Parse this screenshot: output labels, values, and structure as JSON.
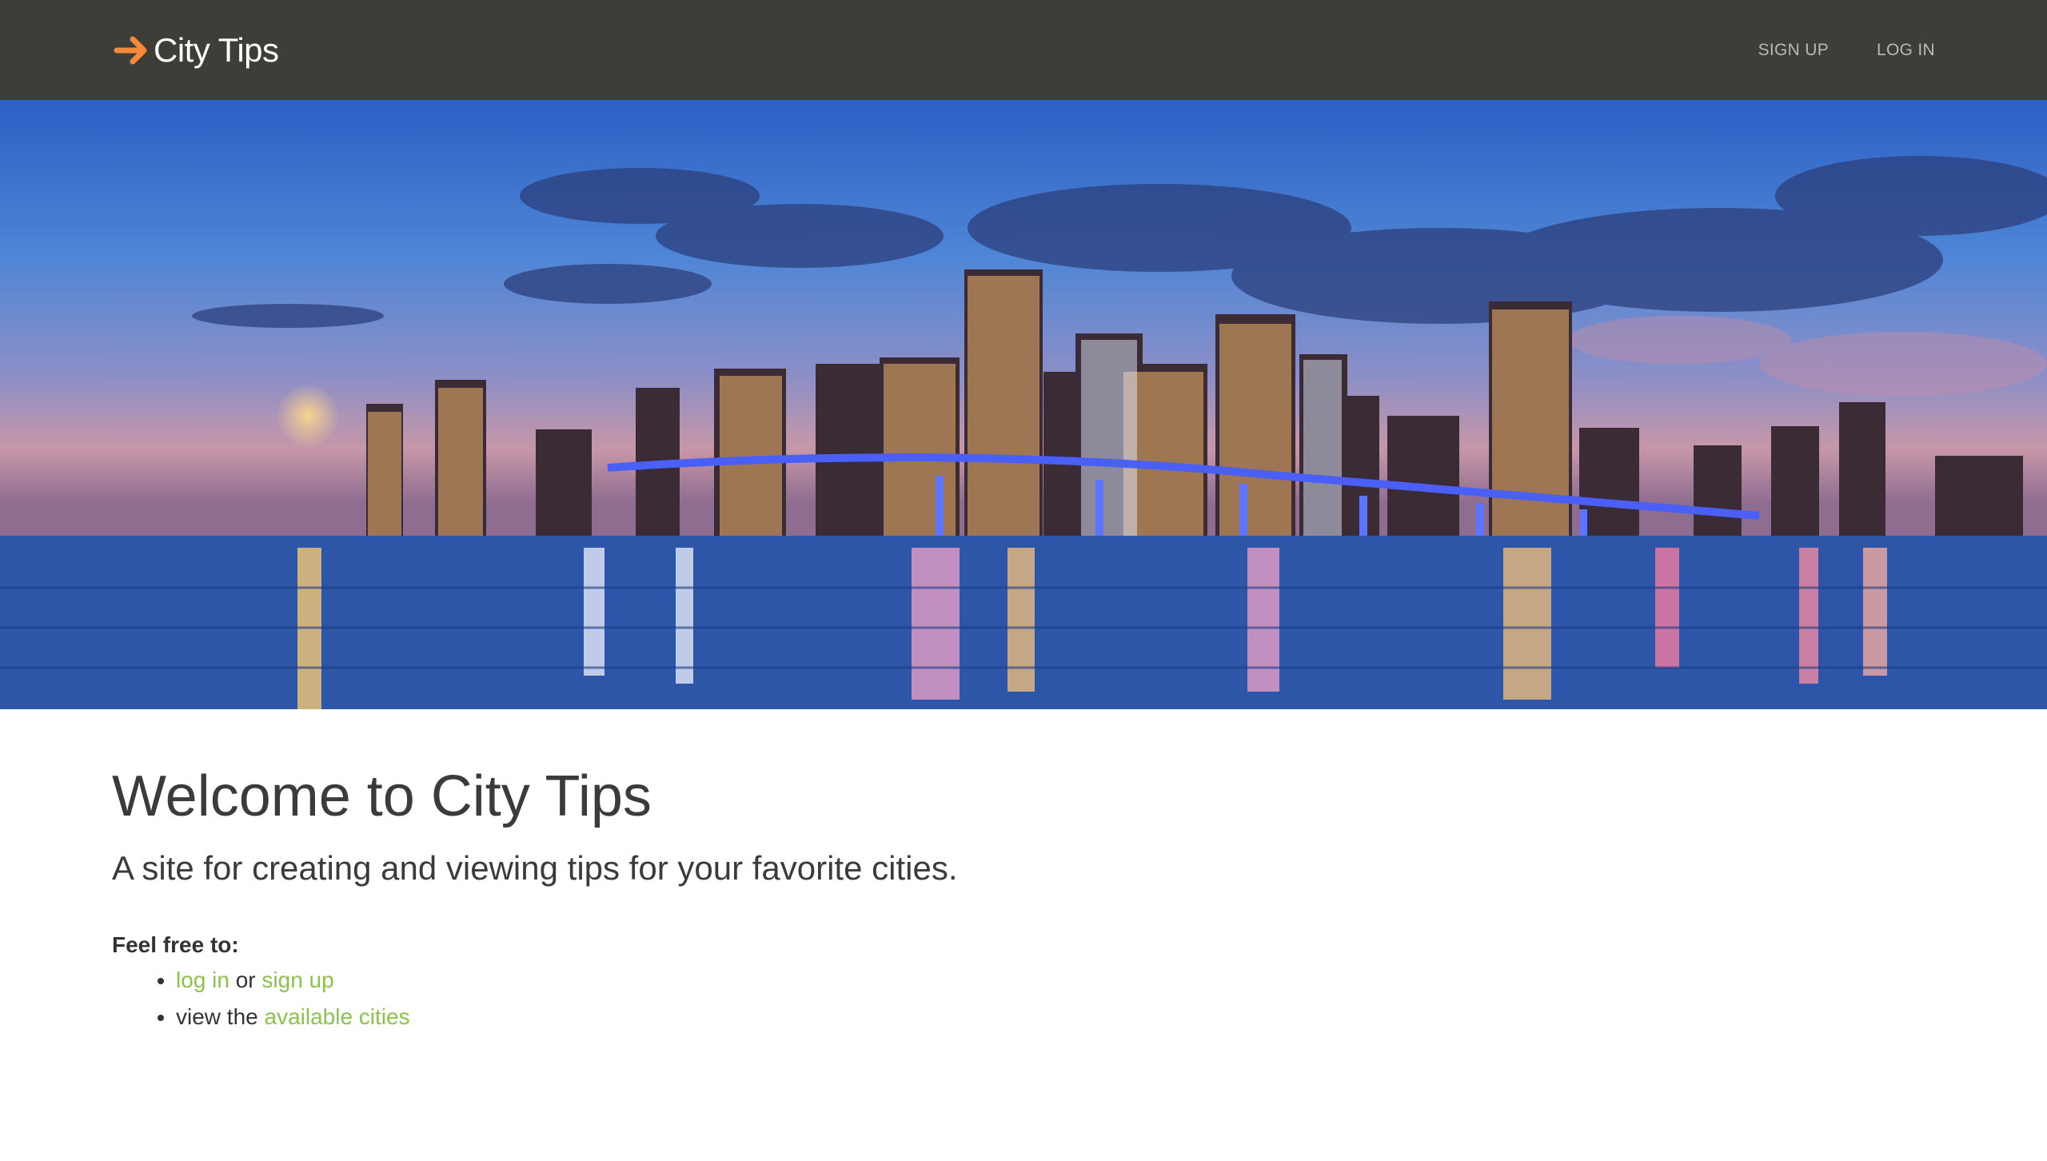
{
  "header": {
    "brand": "City Tips",
    "nav": {
      "signup": "SIGN UP",
      "login": "LOG IN"
    }
  },
  "hero": {
    "image": "city-skyline-night-photo"
  },
  "main": {
    "title": "Welcome to City Tips",
    "subtitle": "A site for creating and viewing tips for your favorite cities.",
    "free_label": "Feel free to:",
    "items": [
      {
        "link1": "log in",
        "connector": "or",
        "link2": "sign up"
      },
      {
        "prefix": "view the",
        "link": "available cities"
      }
    ]
  },
  "colors": {
    "navbar_bg": "#3e3e38",
    "brand_arrow": "#f5893b",
    "link_green": "#8bc34a",
    "nav_text": "#b9b9b3"
  }
}
